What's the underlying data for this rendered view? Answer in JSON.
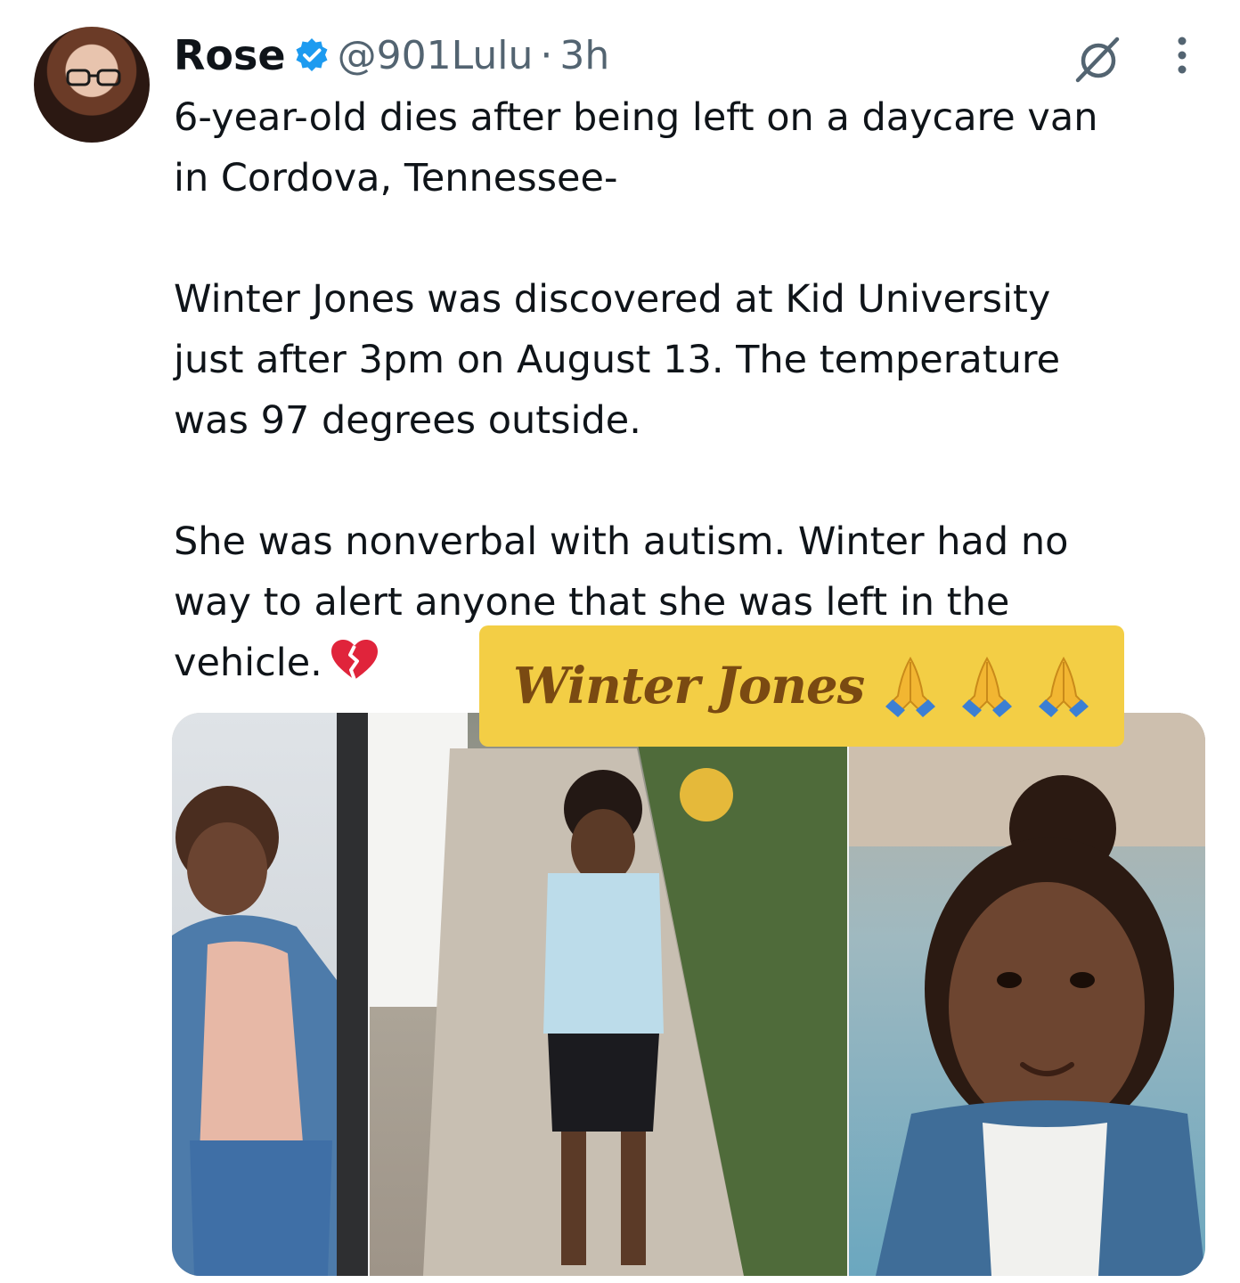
{
  "post": {
    "author": {
      "name": "Rose",
      "handle": "@901Lulu",
      "separator": "·",
      "time": "3h",
      "verified": true,
      "avatar_icon": "avatar-portrait"
    },
    "icons": {
      "grok": "grok-icon",
      "more": "more-options-icon",
      "verified": "verified-badge-icon",
      "emoji": "broken-heart-icon"
    },
    "text": {
      "lines": [
        "6-year-old dies after being left on a daycare van",
        "in Cordova, Tennessee-",
        "",
        "Winter Jones was discovered at Kid University",
        "just after 3pm on August 13. The temperature",
        "was 97 degrees outside.",
        "",
        "She was nonverbal with autism. Winter had no",
        "way to alert anyone that she was left in the",
        "vehicle."
      ]
    },
    "media": {
      "caption": "Winter Jones",
      "caption_emoji_icon": "praying-hands-icon",
      "caption_emoji_count": 3
    }
  },
  "colors": {
    "text": "#0f1419",
    "secondary": "#536471",
    "verified": "#1d9bf0",
    "banner": "#f3ce45",
    "banner_text": "#7a4a12"
  }
}
